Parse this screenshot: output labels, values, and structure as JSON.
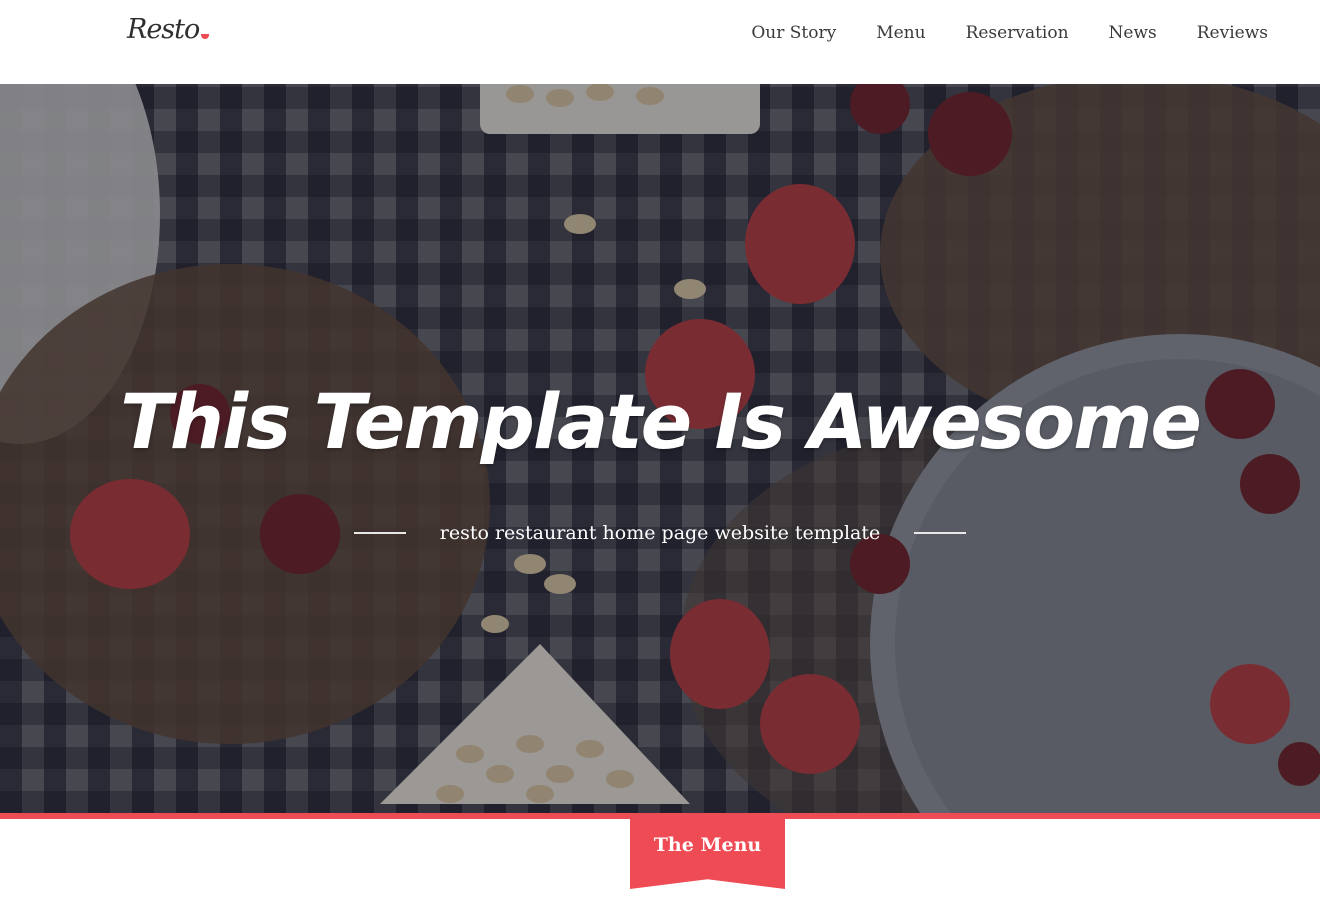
{
  "header": {
    "logo_text": "Resto",
    "nav": [
      "Our Story",
      "Menu",
      "Reservation",
      "News",
      "Reviews"
    ]
  },
  "hero": {
    "headline": "This Template Is Awesome",
    "subline": "resto restaurant home page website template"
  },
  "section": {
    "menu_label": "The Menu"
  },
  "colors": {
    "accent": "#ef4b55",
    "nav_text": "#3a3a3a",
    "logo_text": "#2e2e2e"
  }
}
